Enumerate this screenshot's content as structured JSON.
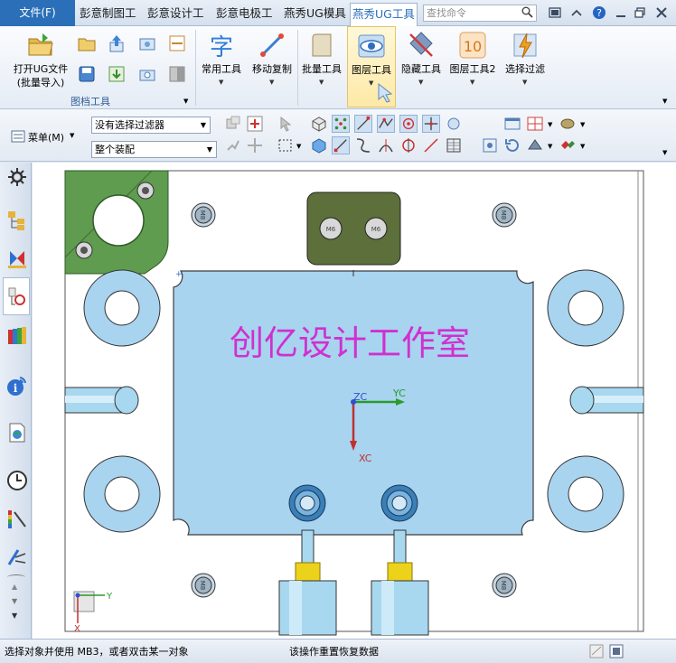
{
  "menubar": {
    "file_label": "文件(F)",
    "tabs": [
      "彭意制图工",
      "彭意设计工",
      "彭意电极工",
      "燕秀UG模具",
      "燕秀UG工具"
    ],
    "search_placeholder": "查找命令"
  },
  "ribbon": {
    "open_label_1": "打开UG文件",
    "open_label_2": "(批量导入)",
    "group_label": "图档工具",
    "tools": [
      "常用工具",
      "移动复制",
      "批量工具",
      "图层工具",
      "隐藏工具",
      "图层工具2",
      "选择过滤"
    ],
    "layer2_icon_text": "10"
  },
  "toolbar": {
    "menu_label": "菜单(M)",
    "filter_value": "没有选择过滤器",
    "assembly_value": "整个装配"
  },
  "canvas": {
    "watermark_text": "创亿设计工作室",
    "axis_zc": "ZC",
    "axis_yc": "YC",
    "axis_xc": "XC",
    "triad_y": "Y",
    "triad_x": "X",
    "screw_label": "M8",
    "fitting_label": "M6"
  },
  "status": {
    "left": "选择对象并使用 MB3，或者双击某一对象",
    "middle": "该操作重置恢复数据"
  },
  "colors": {
    "plate": "#a8d4ef",
    "plate_edge": "#3d3d3d",
    "green_block": "#5f9c4f",
    "dark_block": "#5d6f3a",
    "magenta_text": "#d030d0",
    "accent": "#2b6fb8"
  }
}
